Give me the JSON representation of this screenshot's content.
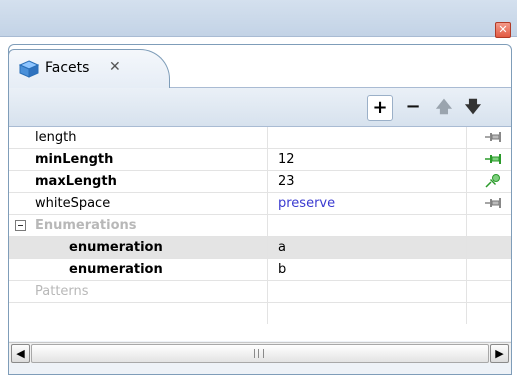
{
  "window": {
    "close_glyph": "✕"
  },
  "tab": {
    "label": "Facets",
    "close_glyph": "✕",
    "icon": "facets-cube-icon"
  },
  "toolbar": {
    "add_label": "+",
    "remove_label": "−",
    "up_label": "🡅",
    "down_label": "🡇"
  },
  "rows": [
    {
      "name": "length",
      "value": "",
      "style": "normal",
      "pin": "pin-grey"
    },
    {
      "name": "minLength",
      "value": "12",
      "style": "bold",
      "pin": "pin-green"
    },
    {
      "name": "maxLength",
      "value": "23",
      "style": "bold",
      "pin": "pin-green-tilted"
    },
    {
      "name": "whiteSpace",
      "value": "preserve",
      "style": "normal",
      "pin": "pin-grey"
    },
    {
      "name": "Enumerations",
      "value": "",
      "style": "group",
      "expanded": true
    },
    {
      "name": "enumeration",
      "value": "a",
      "style": "child",
      "selected": true
    },
    {
      "name": "enumeration",
      "value": "b",
      "style": "child"
    },
    {
      "name": "Patterns",
      "value": "",
      "style": "grey"
    }
  ],
  "colors": {
    "value_blue": "#3a3ad0",
    "pin_green": "#2a9a2a",
    "selection": "#e4e4e4"
  }
}
